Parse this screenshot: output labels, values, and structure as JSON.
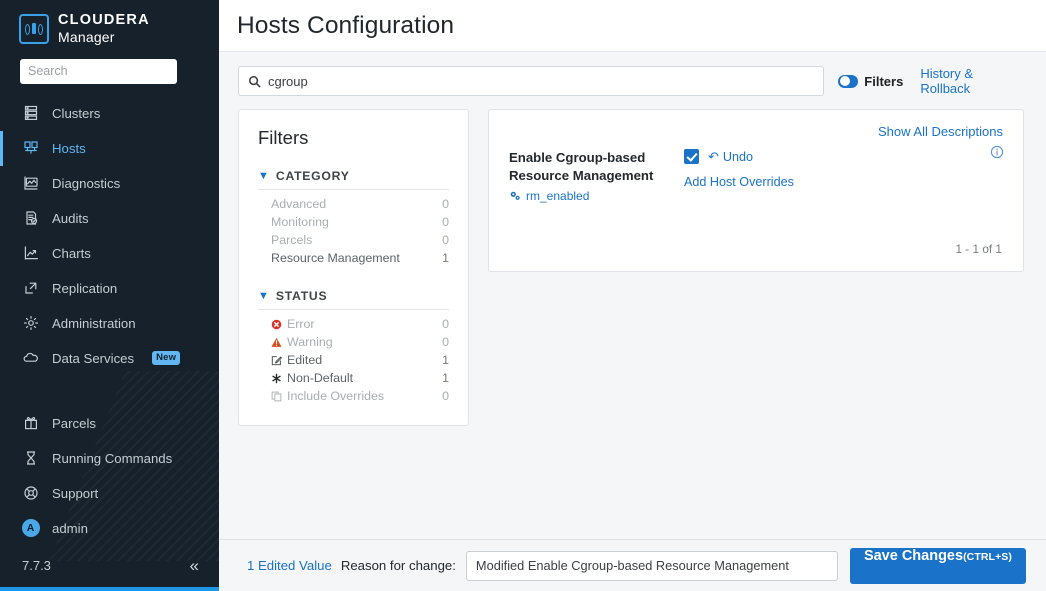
{
  "sidebar": {
    "brand": {
      "line1": "CLOUDERA",
      "line2": "Manager",
      "logo_icon": "cloudera-logo-icon"
    },
    "search": {
      "placeholder": "Search",
      "value": ""
    },
    "items": [
      {
        "label": "Clusters",
        "icon": "clusters-icon",
        "active": false
      },
      {
        "label": "Hosts",
        "icon": "hosts-icon",
        "active": true
      },
      {
        "label": "Diagnostics",
        "icon": "diagnostics-icon",
        "active": false
      },
      {
        "label": "Audits",
        "icon": "audits-icon",
        "active": false
      },
      {
        "label": "Charts",
        "icon": "charts-icon",
        "active": false
      },
      {
        "label": "Replication",
        "icon": "replication-icon",
        "active": false
      },
      {
        "label": "Administration",
        "icon": "gear-icon",
        "active": false
      },
      {
        "label": "Data Services",
        "icon": "cloud-icon",
        "active": false,
        "badge": "New"
      }
    ],
    "items2": [
      {
        "label": "Parcels",
        "icon": "parcels-gift-icon"
      },
      {
        "label": "Running Commands",
        "icon": "hourglass-icon"
      },
      {
        "label": "Support",
        "icon": "lifebuoy-icon"
      },
      {
        "label": "admin",
        "icon": "avatar-icon",
        "avatar_letter": "A"
      }
    ],
    "version": "7.7.3",
    "collapse_icon": "double-chevron-left-icon",
    "accent_color": "#5eb8f5",
    "background_color": "#16212b"
  },
  "header": {
    "title": "Hosts Configuration"
  },
  "search_row": {
    "search_icon": "search-icon",
    "value": "cgroup",
    "placeholder": "Search",
    "filters_label": "Filters",
    "filters_toggle_on": true,
    "history_link": "History & Rollback"
  },
  "filters": {
    "heading": "Filters",
    "groups": [
      {
        "title": "CATEGORY",
        "expanded": true,
        "rows": [
          {
            "label": "Advanced",
            "count": "0",
            "dim": true,
            "icon": ""
          },
          {
            "label": "Monitoring",
            "count": "0",
            "dim": true,
            "icon": ""
          },
          {
            "label": "Parcels",
            "count": "0",
            "dim": true,
            "icon": ""
          },
          {
            "label": "Resource Management",
            "count": "1",
            "dim": false,
            "icon": ""
          }
        ]
      },
      {
        "title": "STATUS",
        "expanded": true,
        "rows": [
          {
            "label": "Error",
            "count": "0",
            "dim": true,
            "icon": "error-icon"
          },
          {
            "label": "Warning",
            "count": "0",
            "dim": true,
            "icon": "warning-icon"
          },
          {
            "label": "Edited",
            "count": "1",
            "dim": false,
            "icon": "edited-pencil-icon"
          },
          {
            "label": "Non-Default",
            "count": "1",
            "dim": false,
            "icon": "non-default-asterisk-icon"
          },
          {
            "label": "Include Overrides",
            "count": "0",
            "dim": true,
            "icon": "overrides-copy-icon"
          }
        ]
      }
    ]
  },
  "config": {
    "show_all_descriptions": "Show All Descriptions",
    "property_name": "Enable Cgroup-based Resource Management",
    "property_key": "rm_enabled",
    "property_key_icon": "gears-icon",
    "checkbox_checked": true,
    "undo_label": "Undo",
    "undo_icon": "undo-arrow-icon",
    "add_host_overrides": "Add Host Overrides",
    "info_icon": "info-circle-icon",
    "result_count": "1 - 1 of 1"
  },
  "bottom_bar": {
    "edited_value_label": "1 Edited Value",
    "reason_label": "Reason for change:",
    "reason_value": "Modified Enable Cgroup-based Resource Management",
    "reason_placeholder": "Reason for change",
    "save_label": "Save Changes",
    "save_shortcut": "(CTRL+S)",
    "accent_color": "#1a73c8"
  }
}
